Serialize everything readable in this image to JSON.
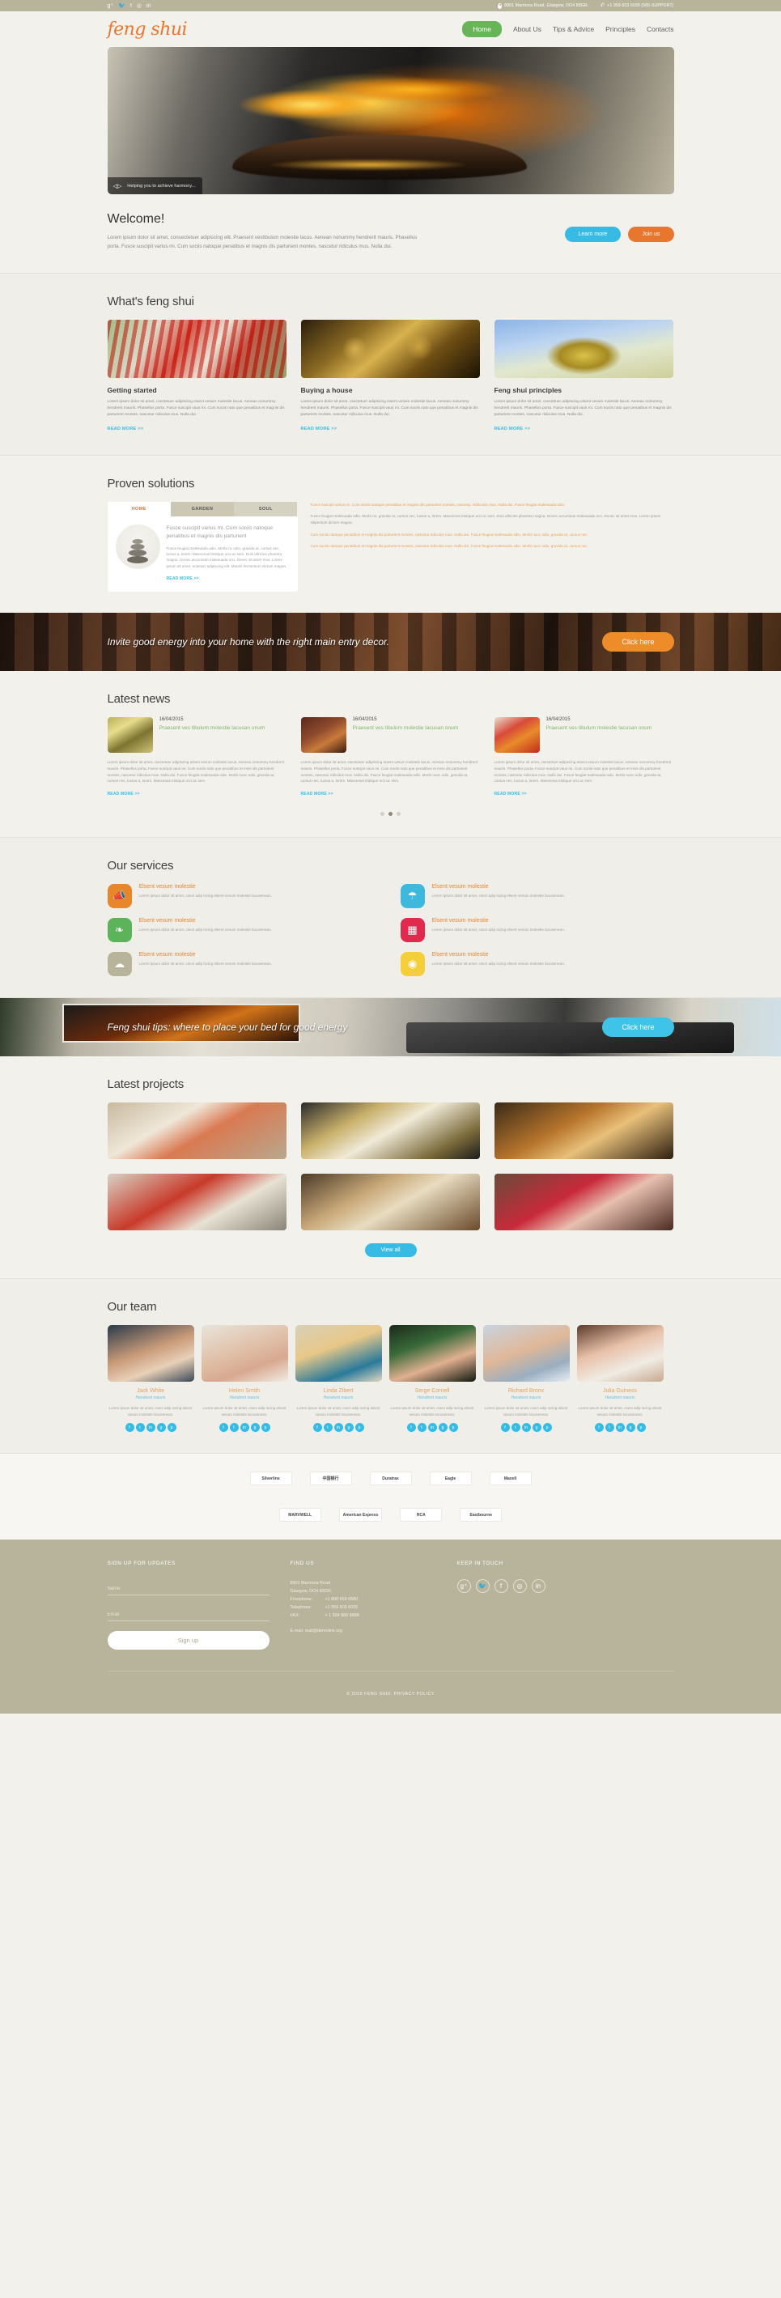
{
  "topbar": {
    "social": [
      "g+",
      "twitter",
      "facebook",
      "pinterest",
      "linkedin"
    ],
    "address": "8901 Marmora Road, Glasgow, DO4 89GR.",
    "phone": "+1 959 603 6035 (565-SUPPORT)"
  },
  "header": {
    "logo": "feng shui",
    "nav": [
      {
        "label": "Home",
        "active": true
      },
      {
        "label": "About Us",
        "active": false
      },
      {
        "label": "Tips & Advice",
        "active": false
      },
      {
        "label": "Principles",
        "active": false
      },
      {
        "label": "Contacts",
        "active": false
      }
    ]
  },
  "hero": {
    "caption": "Helping you to achieve harmony..."
  },
  "welcome": {
    "title": "Welcome!",
    "body": "Lorem ipsum dolor sit amet, consectetuer adipiscing elit. Praesent vestibulum molestie lacus. Aenean nonummy hendrerit mauris. Phasellus porta. Fusce suscipit varius mi. Cum sociis natoque penatibus et magnis dis parturient montes, nascetur ridiculus mus. Nulla dui.",
    "btn_learn": "Learn more",
    "btn_join": "Join us"
  },
  "whats": {
    "title": "What's feng shui",
    "cards": [
      {
        "title": "Getting started",
        "body": "Lorem ipsum dolor sit amet, csectetuer adipiscing eisent vesum molestie lacus. Aenean nonummy hendrerit mauris. Phasellus porta. Fusce suscipit vaus mi. Cum sociis nato que penatibus et magnis dis parturient montes, nascetur ridiculus mus. Nulla dui.",
        "read": "READ MORE >>"
      },
      {
        "title": "Buying a house",
        "body": "Lorem ipsum dolor sit amet, csectetuer adipiscing eisent vesum molestie lacus. Aenean nonummy hendrerit mauris. Phasellus porta. Fusce suscipit vaus mi. Cum sociis nato que penatibus et magnis dis parturient montes, nascetur ridiculus mus. Nulla dui.",
        "read": "READ MORE >>"
      },
      {
        "title": "Feng shui principles",
        "body": "Lorem ipsum dolor sit amet, csectetuer adipiscing eisent vesum molestie lacus. Aenean nonummy hendrerit mauris. Phasellus porta. Fusce suscipit vaus mi. Cum sociis nato que penatibus et magnis dis parturient montes, nascetur ridiculus mus. Nulla dui.",
        "read": "READ MORE >>"
      }
    ]
  },
  "solutions": {
    "title": "Proven solutions",
    "tabs": [
      {
        "label": "HOME",
        "active": true
      },
      {
        "label": "GARDEN",
        "active": false
      },
      {
        "label": "SOUL",
        "active": false
      }
    ],
    "lead": "Fusce suscipit varius mi. Cum sociis natoque penatibus et magnis dis parturient",
    "body": "Fusce feugiat malesuada odio. Morbi nc odio, gravida at, cursus nec, luctus a, lorem. Maecenas tristique orci ac sem. Duis ultricies pharetra magna. Donec accumsan malesuada orci. Donec sit amet eros. Lorem ipsum sit amet, ectetuer adipiscing elit. Mauris fermentum dictum magna.",
    "read": "READ MORE >>",
    "side": [
      {
        "style": "hl",
        "text": "Fusce suscipit varius mi. Cum sociis natoque penatibus et magnis dis parturient montes, nascetur. Ridiculus mus. Nulla dui. Fusce feugiat malesuada odio."
      },
      {
        "style": "dk",
        "text": "Fusce feugiat malesuada odio. Morbi no, gravida at, cursus nec, luctus a, lorem. Maecenas tristique orci ac sem. Duis ultricies pharetra magna. Donec accumsan malesuada orci. Donec sit amet eros. Lorem ipsum sitipentum dictum magna."
      },
      {
        "style": "hl",
        "text": "Cum sociis natoque penatibus et magnis dis parturient montes, nascetur ridiculus mus. Nulla dui. Fusce feugiat malesuada odio. Morbi nunc odio, gravida at, cursus nec."
      },
      {
        "style": "hl",
        "text": "Cum sociis natoque penatibus et magnis dis parturient montes, nascetur ridiculus mus. Nulla dui. Fusce feugiat malesuada odio. Morbi nunc odio, gravida at, cursus nec."
      }
    ]
  },
  "banner1": {
    "text": "Invite good energy into your home with the right main entry decor.",
    "cta": "Click here",
    "cta_color": "#ee8c2a"
  },
  "news": {
    "title": "Latest news",
    "items": [
      {
        "date": "16/04/2015",
        "title": "Praesent ves tibulum molestie lacusan onum",
        "body": "Lorem ipsum dolor sit amet, csectetuer adipiscing eisent vesum molestie lacus. Aenean nonummy hendrerit mauris. Phasellus porta. Fusce suscipit vaus mi. Cum sociis nato que penatibus et mnis dis parturient montes, nascetur ridiculus mus. Nulla dui. Fusce feugiat malesuada odio. Morbi nunc odio, gravida at, cursus nec, luctus a, lorem. Maecenas tristique orci ac sem.",
        "read": "READ MORE >>"
      },
      {
        "date": "16/04/2015",
        "title": "Praesent ves tibulum molestie lacusan onum",
        "body": "Lorem ipsum dolor sit amet, csectetuer adipiscing eisent vesum molestie lacus. Aenean nonummy hendrerit mauris. Phasellus porta. Fusce suscipit vaus mi. Cum sociis nato que penatibus et mnis dis parturient montes, nascetur ridiculus mus. Nulla dui. Fusce feugiat malesuada odio. Morbi nunc odio, gravida at, cursus nec, luctus a, lorem. Maecenas tristique orci ac sem.",
        "read": "READ MORE >>"
      },
      {
        "date": "16/04/2015",
        "title": "Praesent ves tibulum molestie lacusan onum",
        "body": "Lorem ipsum dolor sit amet, csectetuer adipiscing eisent vesum molestie lacus. Aenean nonummy hendrerit mauris. Phasellus porta. Fusce suscipit vaus mi. Cum sociis nato que penatibus et mnis dis parturient montes, nascetur ridiculus mus. Nulla dui. Fusce feugiat malesuada odio. Morbi nunc odio, gravida at, cursus nec, luctus a, lorem. Maecenas tristique orci ac sem.",
        "read": "READ MORE >>"
      }
    ],
    "pager": [
      "1",
      "2",
      "3"
    ],
    "pager_active": 1
  },
  "services": {
    "title": "Our services",
    "items": [
      {
        "icon": "megaphone-icon",
        "glyph": "✉",
        "color": "#e8862c",
        "title": "Elsent vesum molestie",
        "body": "Lorem ipsum dolor sit amet, csect adip iscing elsent vesum molestie lacusenean."
      },
      {
        "icon": "umbrella-icon",
        "glyph": "☂",
        "color": "#3fb8dd",
        "title": "Elsent vesum molestie",
        "body": "Lorem ipsum dolor sit amet, csect adip iscing elsent vesum molestie lacusenean."
      },
      {
        "icon": "leaf-icon",
        "glyph": "❦",
        "color": "#5cb35a",
        "title": "Elsent vesum molestie",
        "body": "Lorem ipsum dolor sit amet, csect adip iscing elsent vesum molestie lacusenean."
      },
      {
        "icon": "calendar-icon",
        "glyph": "▦",
        "color": "#e02a4e",
        "title": "Elsent vesum molestie",
        "body": "Lorem ipsum dolor sit amet, csect adip iscing elsent vesum molestie lacusenean."
      },
      {
        "icon": "cloud-icon",
        "glyph": "☁",
        "color": "#b8b49c",
        "title": "Elsent vesum molestie",
        "body": "Lorem ipsum dolor sit amet, csect adip iscing elsent vesum molestie lacusenean."
      },
      {
        "icon": "target-icon",
        "glyph": "◉",
        "color": "#f4cf3a",
        "title": "Elsent vesum molestie",
        "body": "Lorem ipsum dolor sit amet, csect adip iscing elsent vesum molestie lacusenean."
      }
    ]
  },
  "banner2": {
    "text": "Feng shui tips: where to place your bed for good energy",
    "cta": "Click here",
    "cta_color": "#3fc3e8"
  },
  "projects": {
    "title": "Latest projects",
    "viewall": "View all",
    "items": [
      "project-1",
      "project-2",
      "project-3",
      "project-4",
      "project-5",
      "project-6"
    ]
  },
  "team": {
    "title": "Our team",
    "members": [
      {
        "name": "Jack White",
        "role": "Hendrent mauris",
        "bio": "Lorem ipsum dolor sit amet, csect adip iscing elsent vesum molestie lacusenean."
      },
      {
        "name": "Helen Smith",
        "role": "Hendrent mauris",
        "bio": "Lorem ipsum dolor sit amet, csect adip iscing elsent vesum molestie lacusenean."
      },
      {
        "name": "Linda Zibert",
        "role": "Hendrent mauris",
        "bio": "Lorem ipsum dolor sit amet, csect adip iscing elsent vesum molestie lacusenean."
      },
      {
        "name": "Serge Cornell",
        "role": "Hendrent mauris",
        "bio": "Lorem ipsum dolor sit amet, csect adip iscing elsent vesum molestie lacusenean."
      },
      {
        "name": "Richard Bronx",
        "role": "Hendrent mauris",
        "bio": "Lorem ipsum dolor sit amet, csect adip iscing elsent vesum molestie lacusenean."
      },
      {
        "name": "Julia Guiness",
        "role": "Hendrent mauris",
        "bio": "Lorem ipsum dolor sit amet, csect adip iscing elsent vesum molestie lacusenean."
      }
    ],
    "social": [
      "f",
      "t",
      "in",
      "g+",
      "p"
    ]
  },
  "partners": {
    "logos": [
      "Silverline",
      "中国银行",
      "Duratrax",
      "Eagle",
      "Maxell",
      "MARVWELL",
      "American Express",
      "RCA",
      "Eastbourne"
    ]
  },
  "footer": {
    "signup_heading": "SIGN UP FOR UPDATES",
    "name_placeholder": "Name",
    "email_placeholder": "Email",
    "signup_button": "Sign up",
    "find_heading": "FIND US",
    "address_line1": "8901 Marmora Road",
    "address_line2": "Glasgow, DO4 89GR.",
    "freephone_label": "Freephone:",
    "freephone_value": "+1 800 559 6580",
    "telephone_label": "Telephone:",
    "telephone_value": "+1 959 603 6035",
    "fax_label": "FAX:",
    "fax_value": "+ 1 504 889 9898",
    "email": "E-mail: mail@demolink.org",
    "keep_heading": "KEEP IN TOUCH",
    "social": [
      "g+",
      "t",
      "f",
      "p",
      "in"
    ],
    "copyright": "© 2015 FENG SHUI. PRIVACY POLICY"
  }
}
